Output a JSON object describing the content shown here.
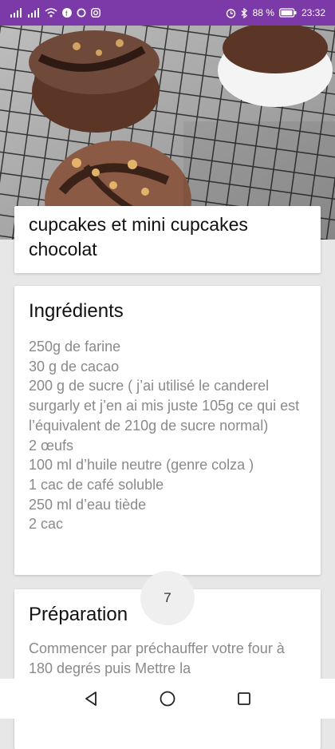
{
  "status_bar": {
    "signal_icons": [
      "signal-icon",
      "signal-icon",
      "wifi-icon",
      "facebook-icon",
      "o-icon",
      "camera-icon"
    ],
    "battery_percent": "88 %",
    "time": "23:32"
  },
  "recipe": {
    "title": "cupcakes et mini cupcakes chocolat",
    "ingredients": {
      "heading": "Ingrédients",
      "items": [
        "250g de farine",
        "30 g de cacao",
        "200 g de sucre ( j’ai utilisé le canderel surgarly et j’en ai mis juste 105g ce qui est l’équivalent de 210g de sucre normal)",
        "2 œufs",
        "100 ml d’huile neutre (genre colza )",
        "1 cac de café soluble",
        "250 ml d’eau tiède",
        "2 cac"
      ]
    },
    "preparation": {
      "heading": "Préparation",
      "text": "Commencer par préchauffer votre four à 180 degrés puis Mettre la"
    },
    "fab_label": "7"
  },
  "navigation": {
    "back": "back-icon",
    "home": "home-icon",
    "recents": "recents-icon"
  }
}
